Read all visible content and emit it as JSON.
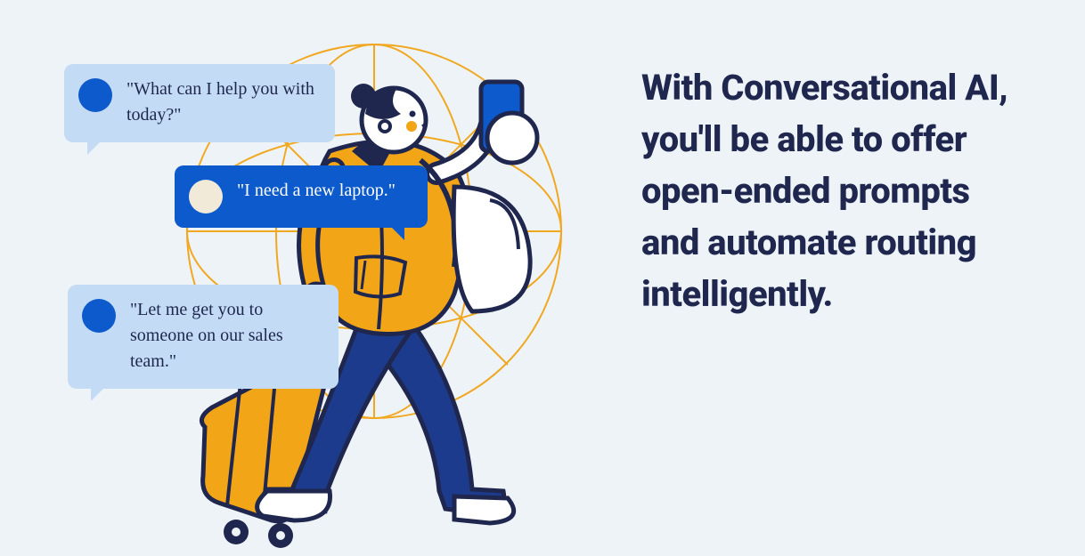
{
  "headline": "With Conversational AI, you'll be able to offer open-ended prompts and automate routing intelligently.",
  "bubbles": {
    "b1": {
      "text": "\"What can I help you with today?\""
    },
    "b2": {
      "text": "\"I need a new laptop.\""
    },
    "b3": {
      "text": "\"Let me get you to someone on our sales team.\""
    }
  }
}
